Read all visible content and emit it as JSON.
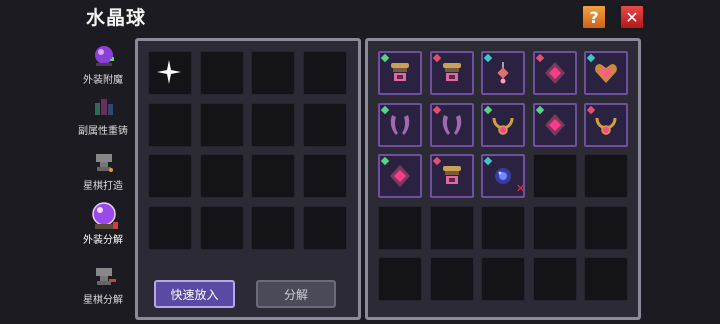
{
  "window": {
    "title": "水晶球"
  },
  "top_buttons": {
    "help_glyph": "?",
    "close_glyph": "✕"
  },
  "sidebar": {
    "items": [
      {
        "label": "外装附魔",
        "icon": "purple-orb-icon",
        "active": false
      },
      {
        "label": "副属性重铸",
        "icon": "potion-bottles-icon",
        "active": false
      },
      {
        "label": "星棋打造",
        "icon": "anvil-icon",
        "active": false
      },
      {
        "label": "外装分解",
        "icon": "crystal-ball-icon",
        "active": true
      },
      {
        "label": "星棋分解",
        "icon": "anvil-hammer-icon",
        "active": false
      }
    ]
  },
  "left_grid": {
    "rows": 4,
    "cols": 4,
    "highlight_slot": 0
  },
  "right_grid": {
    "rows": 5,
    "cols": 5,
    "items": [
      {
        "kind": "helmet",
        "gem": "#5bd28a"
      },
      {
        "kind": "helmet",
        "gem": "#e05070"
      },
      {
        "kind": "pendant",
        "gem": "#3ec9c9"
      },
      {
        "kind": "amulet",
        "gem": "#e05070"
      },
      {
        "kind": "heart",
        "gem": "#3ec9c9"
      },
      {
        "kind": "horns",
        "gem": "#5bd28a"
      },
      {
        "kind": "horns",
        "gem": "#e05070"
      },
      {
        "kind": "necklace",
        "gem": "#5bd28a"
      },
      {
        "kind": "amulet",
        "gem": "#5bd28a"
      },
      {
        "kind": "necklace",
        "gem": "#e05070"
      },
      {
        "kind": "amulet",
        "gem": "#5bd28a"
      },
      {
        "kind": "helmet",
        "gem": "#e05070"
      },
      {
        "kind": "orb",
        "gem": "#3ec9c9",
        "marked": true
      }
    ]
  },
  "buttons": {
    "quick_add": "快速放入",
    "decompose": "分解"
  },
  "colors": {
    "accent": "#5a4aa4",
    "panel": "#2c2b35",
    "frame": "#8b8a98"
  }
}
